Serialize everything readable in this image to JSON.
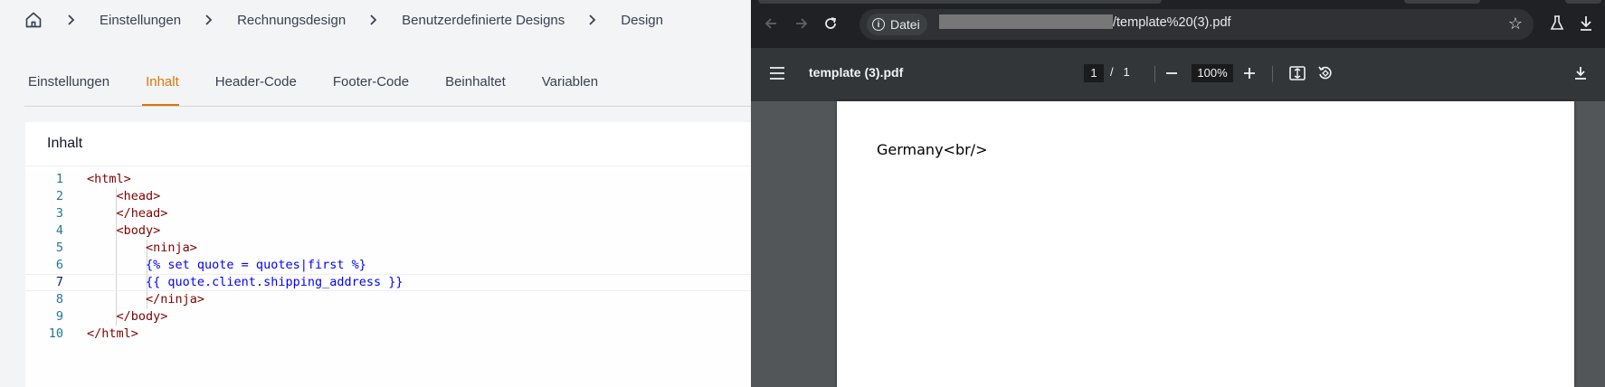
{
  "breadcrumb": {
    "home_icon": "home-icon",
    "items": [
      "Einstellungen",
      "Rechnungsdesign",
      "Benutzerdefinierte Designs",
      "Design"
    ]
  },
  "tabs": [
    "Einstellungen",
    "Inhalt",
    "Header-Code",
    "Footer-Code",
    "Beinhaltet",
    "Variablen"
  ],
  "active_tab": "Inhalt",
  "card": {
    "title": "Inhalt"
  },
  "editor": {
    "current_line": 7,
    "lines": [
      {
        "num": "1",
        "text": "<html>"
      },
      {
        "num": "2",
        "text": "    <head>"
      },
      {
        "num": "3",
        "text": "    </head>"
      },
      {
        "num": "4",
        "text": "    <body>"
      },
      {
        "num": "5",
        "text": "        <ninja>"
      },
      {
        "num": "6",
        "text": "        {% set quote = quotes|first %}"
      },
      {
        "num": "7",
        "text": "        {{ quote.client.shipping_address }}"
      },
      {
        "num": "8",
        "text": "        </ninja>"
      },
      {
        "num": "9",
        "text": "    </body>"
      },
      {
        "num": "10",
        "text": "</html>"
      }
    ]
  },
  "browser": {
    "chip_label": "Datei",
    "url_visible": "/template%20(3).pdf",
    "pdf": {
      "title": "template (3).pdf",
      "page_current": "1",
      "page_sep": "/",
      "page_total": "1",
      "zoom": "100%",
      "content": "Germany<br/>"
    }
  },
  "colors": {
    "accent": "#d97706",
    "tag": "#800000",
    "template": "#0000ff",
    "line_number": "#237893"
  }
}
